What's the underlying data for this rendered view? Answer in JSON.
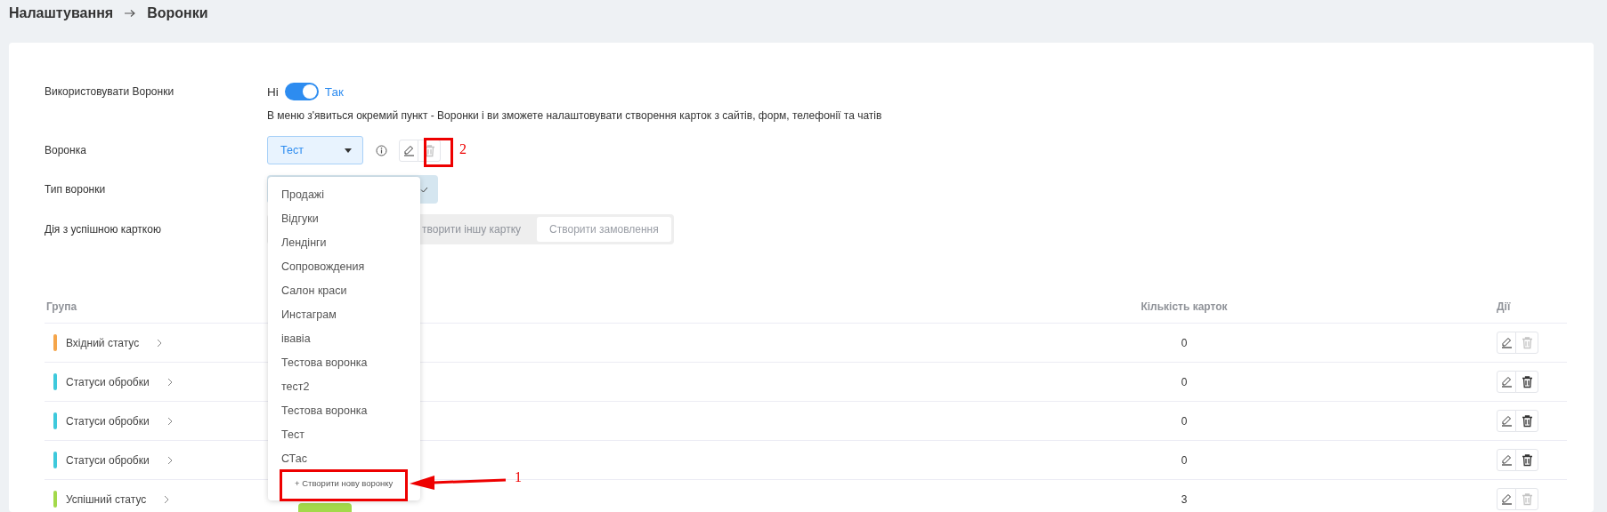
{
  "breadcrumb": [
    "Налаштування",
    "Воронки"
  ],
  "settings": {
    "use_funnels": {
      "label": "Використовувати Воронки",
      "off_label": "Ні",
      "on_label": "Так",
      "on": true,
      "description": "В меню з'явиться окремий пункт - Воронки і ви зможете налаштовувати створення карток з сайтів, форм, телефонії та чатів"
    },
    "funnel": {
      "label": "Воронка",
      "value": "Тест",
      "delete_disabled": true
    },
    "funnel_type": {
      "label": "Тип воронки"
    },
    "success_action": {
      "label": "Дія з успішною карткою",
      "options": [
        {
          "label": "творити іншу картку",
          "selected": false
        },
        {
          "label": "Створити замовлення",
          "selected": true
        }
      ]
    }
  },
  "dropdown": {
    "options": [
      "Продажі",
      "Відгуки",
      "Лендінги",
      "Сопровождения",
      "Салон краси",
      "Инстаграм",
      "івавіа",
      "Тестова воронка",
      "тест2",
      "Тестова воронка",
      "Тест",
      "СТас"
    ],
    "create_label": "+ Створити нову воронку"
  },
  "table": {
    "columns": [
      "Група",
      "Кількість карток",
      "Дії"
    ],
    "rows": [
      {
        "group": "Вхідний статус",
        "color": "#f5a54a",
        "count": "0",
        "delete_disabled": true,
        "has_tag": false
      },
      {
        "group": "Статуси обробки",
        "color": "#3ec9dc",
        "count": "0",
        "delete_disabled": false,
        "has_tag": false
      },
      {
        "group": "Статуси обробки",
        "color": "#3ec9dc",
        "count": "0",
        "delete_disabled": false,
        "has_tag": false
      },
      {
        "group": "Статуси обробки",
        "color": "#3ec9dc",
        "count": "0",
        "delete_disabled": false,
        "has_tag": false
      },
      {
        "group": "Успішний статус",
        "color": "#a3d94a",
        "count": "3",
        "delete_disabled": true,
        "has_tag": true
      }
    ]
  },
  "annotations": [
    {
      "label": "2"
    },
    {
      "label": "1"
    }
  ]
}
